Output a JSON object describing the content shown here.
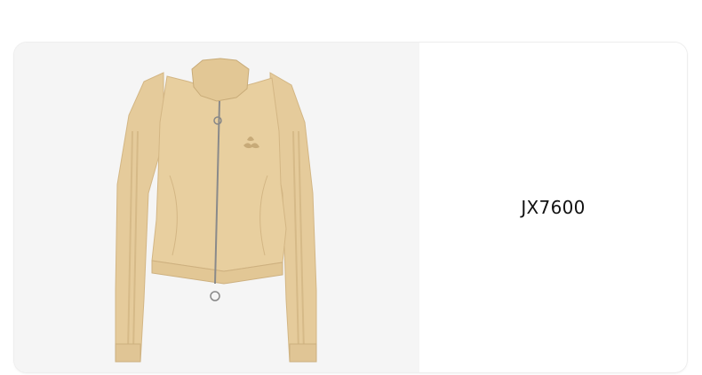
{
  "product": {
    "code": "JX7600",
    "image": {
      "subject": "jacket-image"
    }
  },
  "colors": {
    "card_background": "#ffffff",
    "image_background": "#f5f5f5",
    "jacket": "#e5cb9b",
    "jacket_shadow": "#cdb07f",
    "zipper": "#8a8a8a"
  }
}
